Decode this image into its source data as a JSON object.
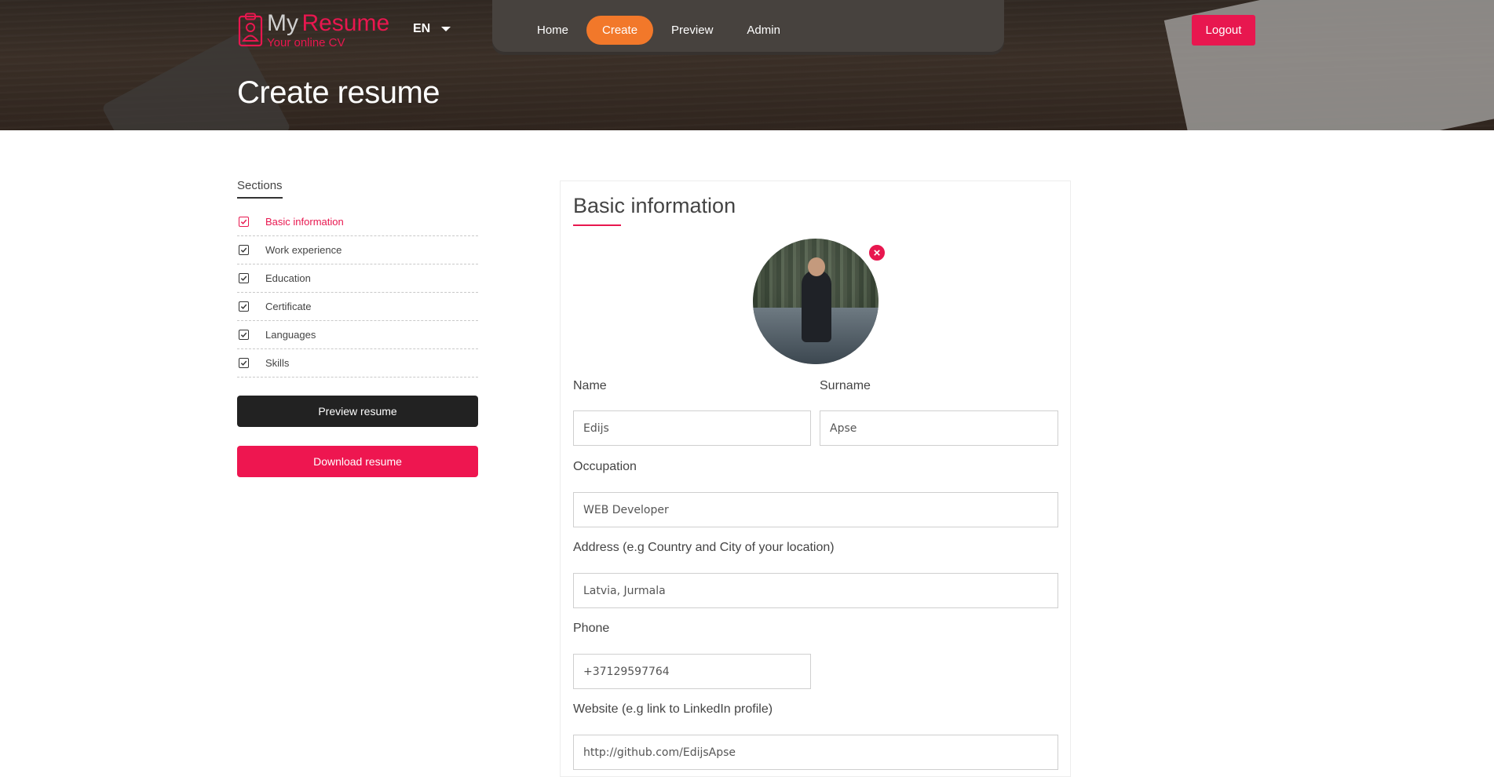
{
  "brand": {
    "name_part1": "My",
    "name_part2": "Resume",
    "tagline": "Your online CV",
    "accent_color": "#e8174f",
    "logo_icon": "clipboard-person-icon"
  },
  "header": {
    "language": "EN",
    "nav": [
      {
        "label": "Home",
        "active": false
      },
      {
        "label": "Create",
        "active": true
      },
      {
        "label": "Preview",
        "active": false
      },
      {
        "label": "Admin",
        "active": false
      }
    ],
    "logout_label": "Logout",
    "page_title": "Create resume",
    "active_nav_color": "#f2782a"
  },
  "sidebar": {
    "heading": "Sections",
    "items": [
      {
        "label": "Basic information",
        "checked": true,
        "active": true
      },
      {
        "label": "Work experience",
        "checked": true,
        "active": false
      },
      {
        "label": "Education",
        "checked": true,
        "active": false
      },
      {
        "label": "Certificate",
        "checked": true,
        "active": false
      },
      {
        "label": "Languages",
        "checked": true,
        "active": false
      },
      {
        "label": "Skills",
        "checked": true,
        "active": false
      }
    ],
    "preview_button": "Preview resume",
    "download_button": "Download resume"
  },
  "form": {
    "title": "Basic information",
    "photo_remove_icon": "close-icon",
    "fields": {
      "name": {
        "label": "Name",
        "value": "Edijs"
      },
      "surname": {
        "label": "Surname",
        "value": "Apse"
      },
      "occupation": {
        "label": "Occupation",
        "value": "WEB Developer"
      },
      "address": {
        "label": "Address (e.g Country and City of your location)",
        "value": "Latvia, Jurmala"
      },
      "phone": {
        "label": "Phone",
        "value": "+37129597764"
      },
      "website": {
        "label": "Website (e.g link to LinkedIn profile)",
        "value": "http://github.com/EdijsApse"
      }
    }
  }
}
